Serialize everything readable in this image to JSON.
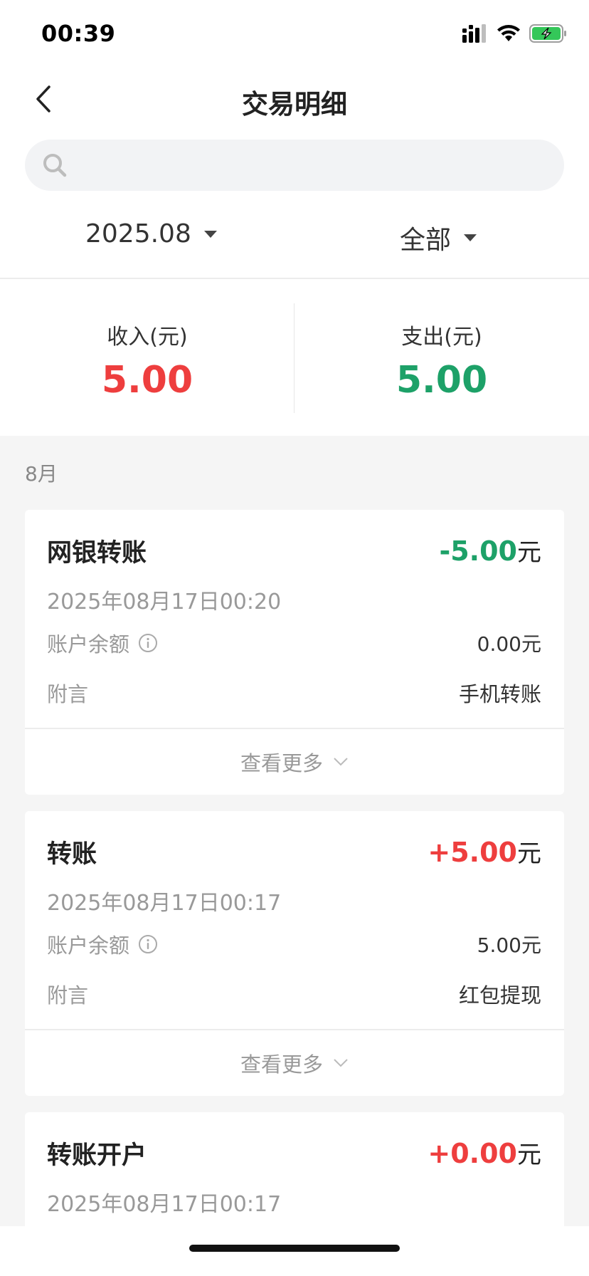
{
  "status_bar": {
    "time": "00:39"
  },
  "nav": {
    "title": "交易明细"
  },
  "search": {
    "placeholder": ""
  },
  "filters": {
    "date": "2025.08",
    "type": "全部"
  },
  "summary": {
    "income_label": "收入(元)",
    "income_value": "5.00",
    "expense_label": "支出(元)",
    "expense_value": "5.00"
  },
  "month_header": "8月",
  "transactions": [
    {
      "title": "网银转账",
      "amount": "-5.00",
      "unit": "元",
      "time": "2025年08月17日00:20",
      "balance_label": "账户余额",
      "balance_value": "0.00元",
      "note_label": "附言",
      "note_value": "手机转账",
      "view_more": "查看更多"
    },
    {
      "title": "转账",
      "amount": "+5.00",
      "unit": "元",
      "time": "2025年08月17日00:17",
      "balance_label": "账户余额",
      "balance_value": "5.00元",
      "note_label": "附言",
      "note_value": "红包提现",
      "view_more": "查看更多"
    },
    {
      "title": "转账开户",
      "amount": "+0.00",
      "unit": "元",
      "time": "2025年08月17日00:17"
    }
  ],
  "colors": {
    "income": "#ee3e3e",
    "expense": "#1da168"
  }
}
